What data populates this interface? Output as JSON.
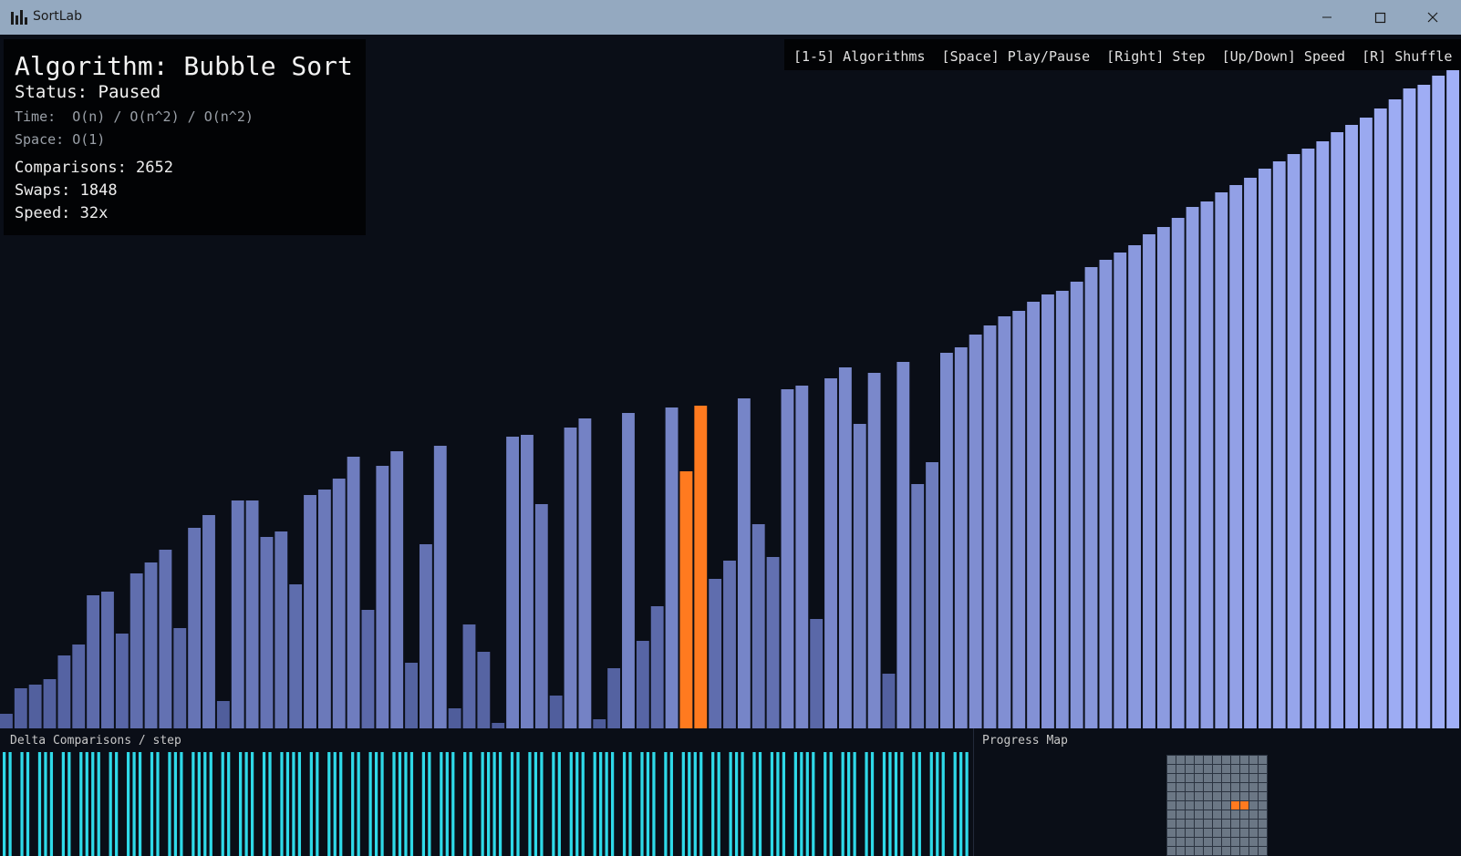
{
  "window": {
    "title": "SortLab",
    "icons": {
      "app": "bar-chart-icon",
      "minimize": "minimize-icon",
      "maximize": "maximize-icon",
      "close": "close-icon"
    }
  },
  "info": {
    "algorithm": "Algorithm: Bubble Sort",
    "status": "Status: Paused",
    "time": "Time:  O(n) / O(n^2) / O(n^2)",
    "space": "Space: O(1)",
    "comparisons": "Comparisons: 2652",
    "swaps": "Swaps: 1848",
    "speed": "Speed: 32x"
  },
  "hints": "[1-5] Algorithms  [Space] Play/Pause  [Right] Step  [Up/Down] Speed  [R] Shuffle",
  "chart_data": {
    "type": "bar",
    "values": [
      16,
      44,
      48,
      54,
      80,
      92,
      146,
      150,
      104,
      170,
      182,
      196,
      110,
      220,
      234,
      30,
      250,
      250,
      210,
      216,
      158,
      256,
      262,
      274,
      298,
      130,
      288,
      304,
      72,
      202,
      310,
      22,
      114,
      84,
      6,
      320,
      322,
      246,
      36,
      330,
      340,
      10,
      66,
      346,
      96,
      134,
      352,
      282,
      354,
      164,
      184,
      362,
      224,
      188,
      372,
      376,
      120,
      384,
      396,
      334,
      390,
      60,
      402,
      268,
      292,
      412,
      418,
      432,
      442,
      452,
      458,
      468,
      476,
      480,
      490,
      506,
      514,
      522,
      530,
      542,
      550,
      560,
      572,
      578,
      588,
      596,
      604,
      614,
      622,
      630,
      636,
      644,
      654,
      662,
      670,
      680,
      690,
      702,
      706,
      716,
      728
    ],
    "highlight": [
      47,
      48
    ],
    "ylim": [
      0,
      761
    ],
    "colors": {
      "bar_low": "#4c5a98",
      "bar_high": "#a5b4fc",
      "highlight": "#ff7a1f"
    }
  },
  "delta_panel": {
    "label": "Delta Comparisons / step",
    "color": "#2fd9e8",
    "values": [
      1,
      1,
      0,
      1,
      1,
      0,
      1,
      1,
      1,
      0,
      1,
      1,
      0,
      1,
      1,
      1,
      1,
      0,
      1,
      1,
      0,
      1,
      1,
      1,
      0,
      1,
      1,
      0,
      1,
      1,
      1,
      0,
      1,
      1,
      1,
      1,
      0,
      1,
      1,
      0,
      1,
      1,
      1,
      0,
      1,
      1,
      0,
      1,
      1,
      1,
      1,
      0,
      1,
      1,
      0,
      1,
      1,
      1,
      0,
      1,
      1,
      0,
      1,
      1,
      1,
      0,
      1,
      1,
      1,
      1,
      0,
      1,
      1,
      0,
      1,
      1,
      1,
      0,
      1,
      1,
      0,
      1,
      1,
      1,
      1,
      0,
      1,
      1,
      0,
      1,
      1,
      1,
      0,
      1,
      1,
      0,
      1,
      1,
      1,
      0,
      1,
      1,
      1,
      1,
      0,
      1,
      1,
      0,
      1,
      1,
      1,
      0,
      1,
      1,
      0,
      1,
      1,
      1,
      1,
      0,
      1,
      1,
      0,
      1,
      1,
      1,
      0,
      1,
      1,
      0,
      1,
      1,
      1,
      0,
      1,
      1,
      1,
      1,
      0,
      1,
      1,
      0,
      1,
      1,
      1,
      0,
      1,
      1,
      0,
      1,
      1,
      1,
      1,
      0,
      1,
      1,
      0,
      1,
      1,
      1,
      0,
      1,
      1,
      1
    ]
  },
  "progress_panel": {
    "label": "Progress Map",
    "rows": 11,
    "cols": 11,
    "active_cells": [
      [
        5,
        7
      ],
      [
        5,
        8
      ]
    ],
    "colors": {
      "cell": "#6b7785",
      "active": "#ff7a1f"
    }
  }
}
